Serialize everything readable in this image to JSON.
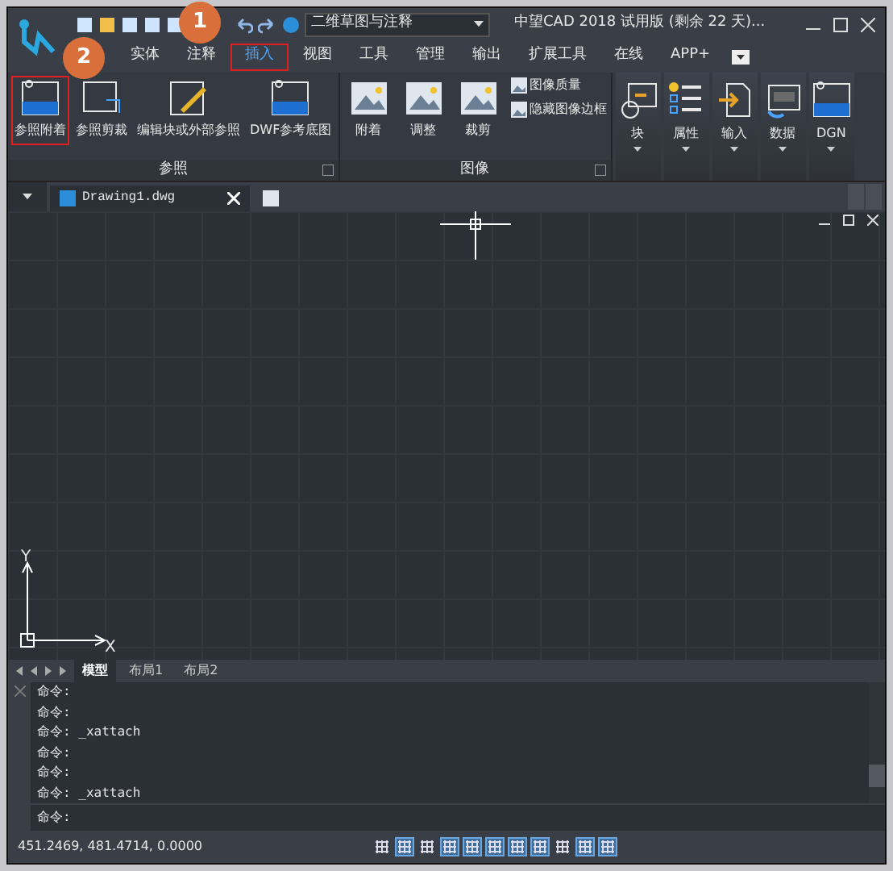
{
  "title_bar": {
    "workspace": "二维草图与注释",
    "title": "中望CAD 2018 试用版 (剩余 22 天)..."
  },
  "tabs": [
    {
      "label": "实体",
      "selected": false
    },
    {
      "label": "注释",
      "selected": false
    },
    {
      "label": "插入",
      "selected": true
    },
    {
      "label": "视图",
      "selected": false
    },
    {
      "label": "工具",
      "selected": false
    },
    {
      "label": "管理",
      "selected": false
    },
    {
      "label": "输出",
      "selected": false
    },
    {
      "label": "扩展工具",
      "selected": false
    },
    {
      "label": "在线",
      "selected": false
    },
    {
      "label": "APP+",
      "selected": false
    }
  ],
  "ribbon": {
    "groups": [
      {
        "title": "参照",
        "buttons": [
          {
            "label": "参照附着",
            "kind": "dwg",
            "highlighted": true
          },
          {
            "label": "参照剪裁",
            "kind": "clip",
            "highlighted": false
          },
          {
            "label": "编辑块或外部参照",
            "kind": "edit",
            "highlighted": false
          },
          {
            "label": "DWF参考底图",
            "kind": "dwf",
            "highlighted": false
          }
        ]
      },
      {
        "title": "图像",
        "buttons": [
          {
            "label": "附着",
            "kind": "image",
            "highlighted": false
          },
          {
            "label": "调整",
            "kind": "adjust",
            "highlighted": false
          },
          {
            "label": "裁剪",
            "kind": "crop",
            "highlighted": false
          }
        ],
        "small_buttons": [
          "图像质量",
          "隐藏图像边框"
        ]
      }
    ],
    "panels": [
      {
        "label": "块",
        "kind": "block"
      },
      {
        "label": "属性",
        "kind": "attr"
      },
      {
        "label": "输入",
        "kind": "import"
      },
      {
        "label": "数据",
        "kind": "data"
      },
      {
        "label": "DGN",
        "kind": "dgn"
      }
    ]
  },
  "document_tab": "Drawing1.dwg",
  "axis": {
    "x": "X",
    "y": "Y"
  },
  "layout_tabs": [
    {
      "label": "模型",
      "selected": true
    },
    {
      "label": "布局1",
      "selected": false
    },
    {
      "label": "布局2",
      "selected": false
    }
  ],
  "command_history": [
    "命令:",
    "命令:",
    "命令: _xattach",
    "命令:",
    "命令:",
    "命令: _xattach"
  ],
  "command_prompt": "命令:",
  "coordinates": "451.2469, 481.4714, 0.0000",
  "status_toggles": [
    {
      "on": false
    },
    {
      "on": true
    },
    {
      "on": false
    },
    {
      "on": true
    },
    {
      "on": true
    },
    {
      "on": true
    },
    {
      "on": true
    },
    {
      "on": true
    },
    {
      "on": false
    },
    {
      "on": true
    },
    {
      "on": true
    }
  ],
  "callouts": [
    "1",
    "2"
  ]
}
